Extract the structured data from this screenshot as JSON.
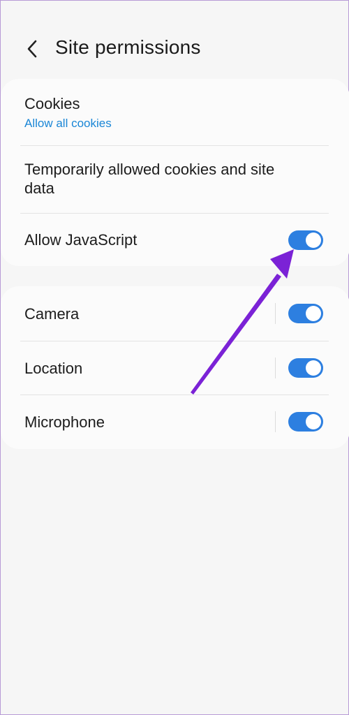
{
  "header": {
    "back_icon": "chevron-left-icon",
    "title": "Site permissions"
  },
  "group1": {
    "cookies": {
      "title": "Cookies",
      "subtitle": "Allow all cookies",
      "subtitle_color": "#1a86d6"
    },
    "temp_cookies": {
      "title_line1": "Temporarily allowed cookies and site",
      "title_line2": "data"
    },
    "javascript": {
      "title": "Allow JavaScript",
      "enabled": true
    }
  },
  "group2": {
    "items": [
      {
        "title": "Camera",
        "enabled": true
      },
      {
        "title": "Location",
        "enabled": true
      },
      {
        "title": "Microphone",
        "enabled": true
      }
    ]
  },
  "colors": {
    "toggle_on": "#2d7fe0",
    "annotation_arrow": "#7b22d6",
    "background": "#f6f6f6",
    "card": "#fbfbfb"
  }
}
